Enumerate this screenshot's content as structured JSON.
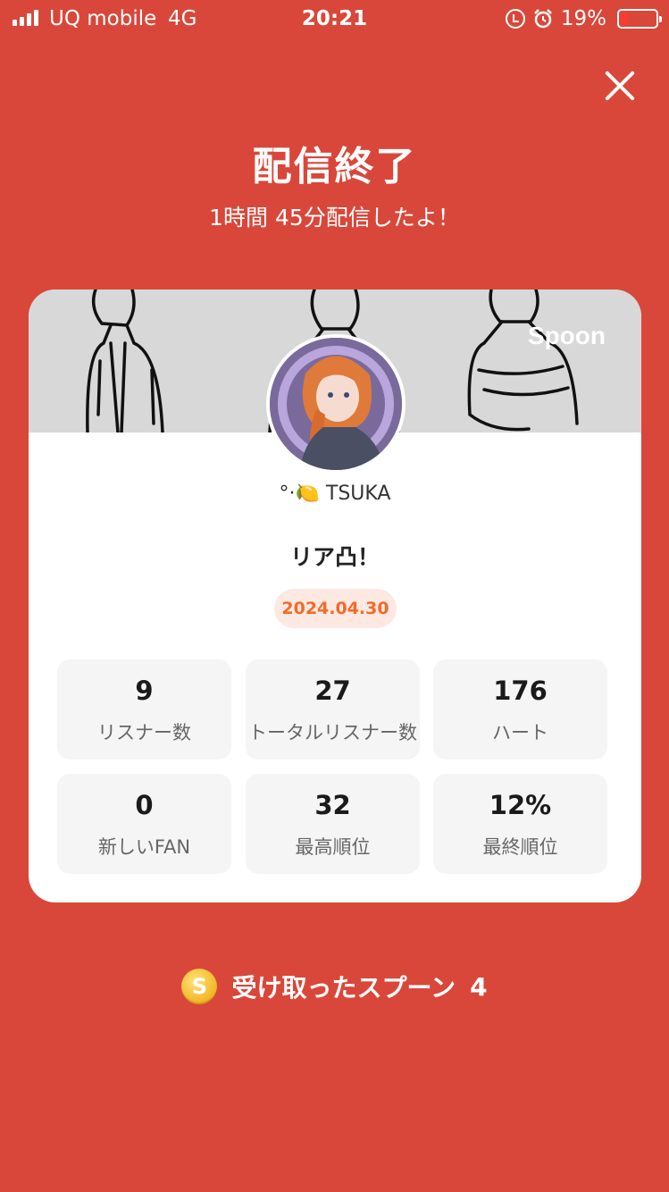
{
  "status_bar": {
    "carrier": "UQ mobile",
    "network": "4G",
    "time": "20:21",
    "battery": "19%",
    "battery_level": 0.19,
    "icons": [
      "signal-icon",
      "orientation-lock-icon",
      "alarm-icon",
      "battery-icon"
    ]
  },
  "header": {
    "close_icon": "close-icon",
    "title": "配信終了",
    "subtitle": "1時間 45分配信したよ！"
  },
  "card": {
    "cover_logo": "Spoon",
    "username": "°·🍋 TSUKA",
    "stream_title": "リア凸！",
    "date": "2024.04.30",
    "stats": [
      {
        "value": "9",
        "label": "リスナー数"
      },
      {
        "value": "27",
        "label": "トータルリスナー数"
      },
      {
        "value": "176",
        "label": "ハート"
      },
      {
        "value": "0",
        "label": "新しいFAN"
      },
      {
        "value": "32",
        "label": "最高順位"
      },
      {
        "value": "12%",
        "label": "最終順位"
      }
    ]
  },
  "spoons": {
    "coin_symbol": "S",
    "label": "受け取ったスプーン",
    "count": "4"
  },
  "colors": {
    "background": "#d9473a",
    "date_text": "#f26a2a",
    "date_bg": "#fde9e2",
    "coin": "#f2b523"
  }
}
